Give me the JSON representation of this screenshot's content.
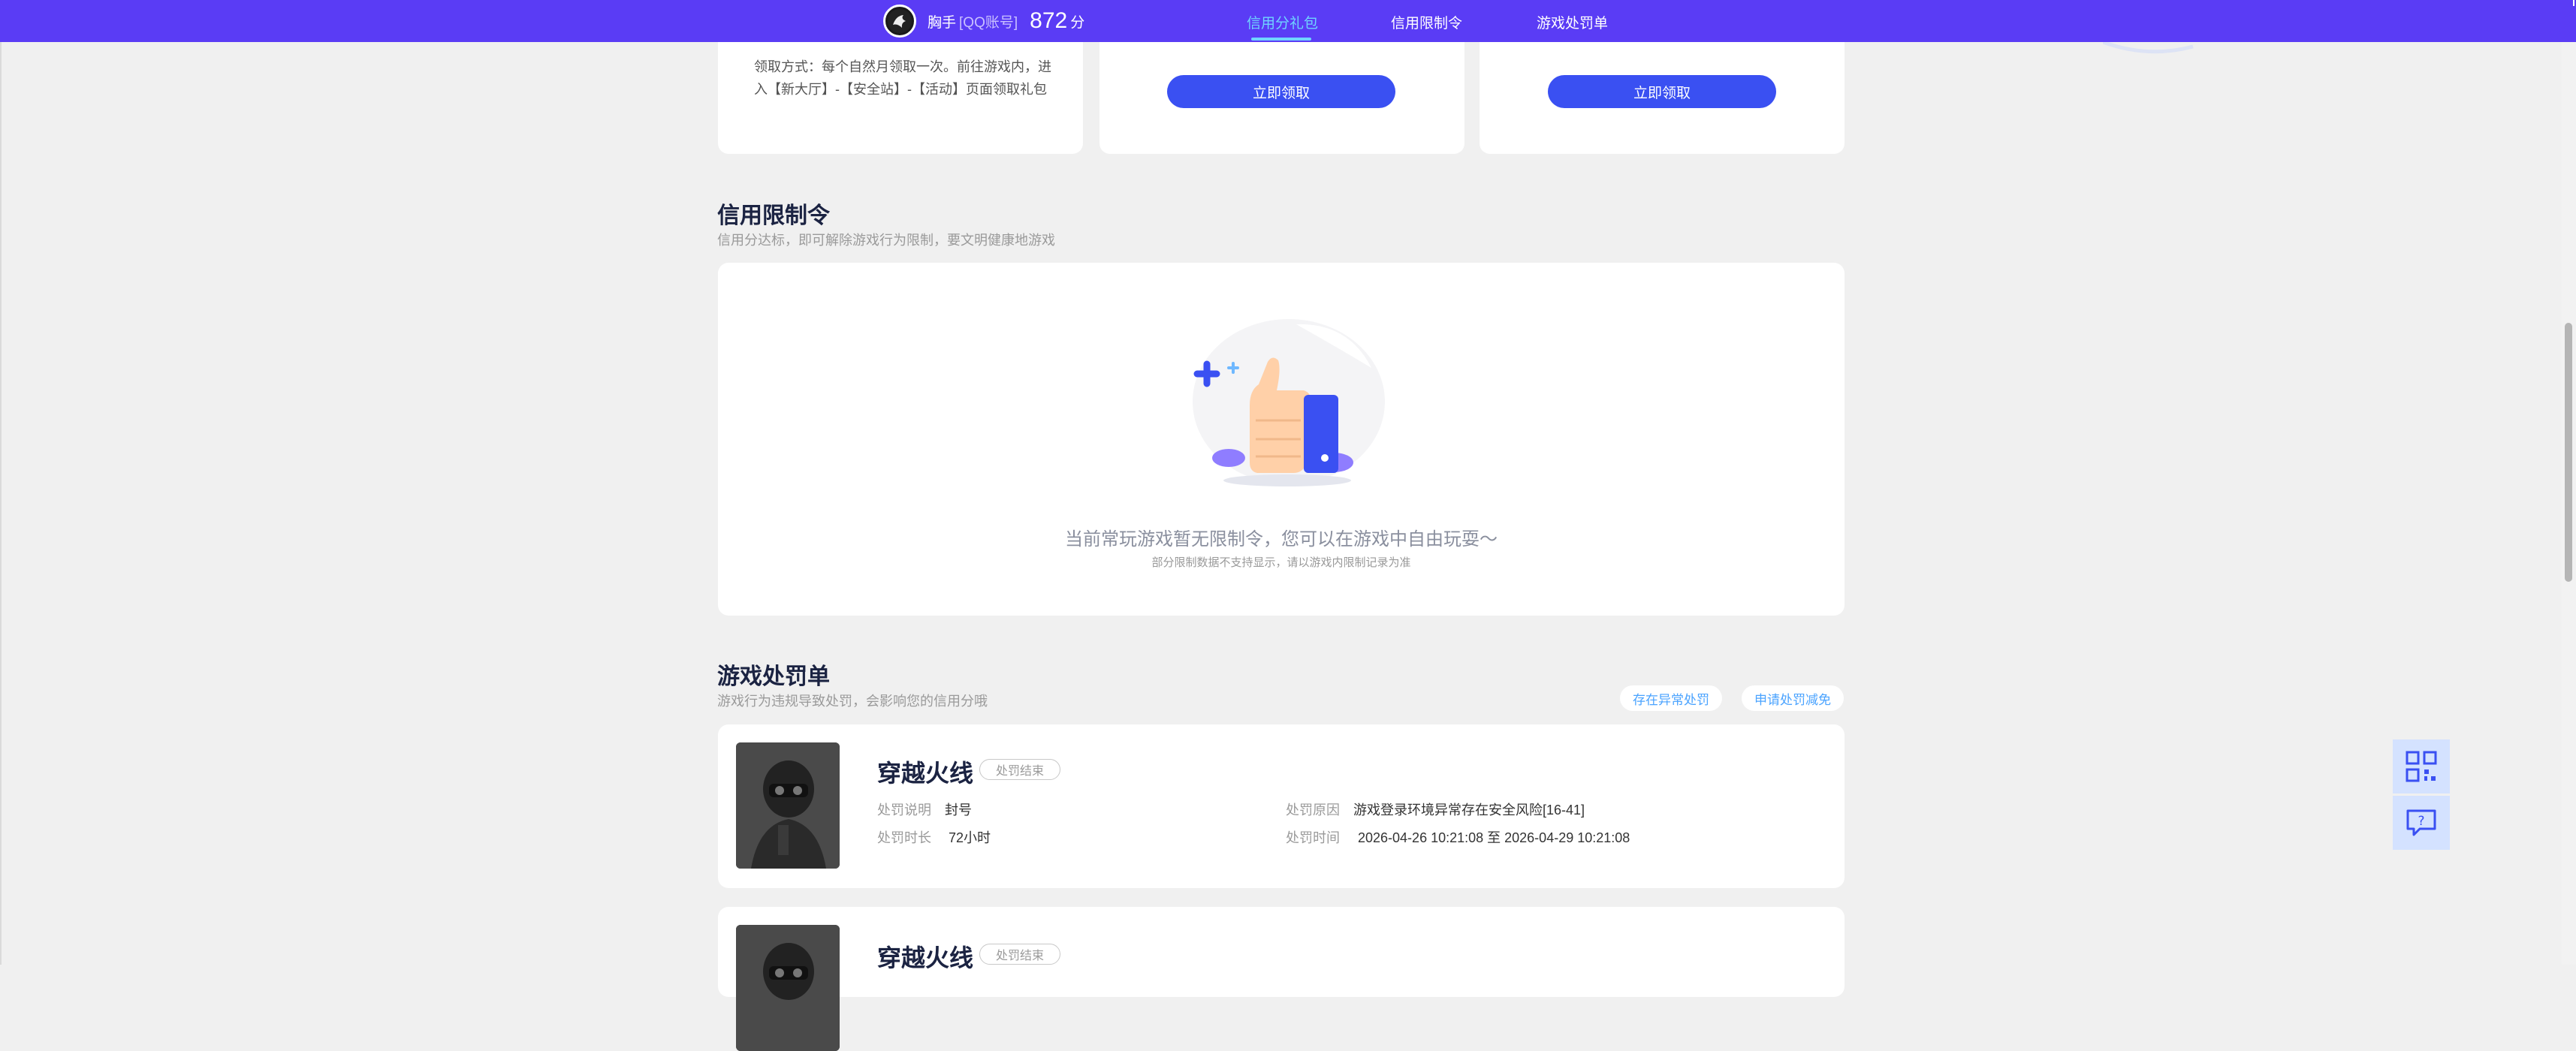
{
  "header": {
    "nickname": "胸手",
    "account_type": "[QQ账号]",
    "score": "872",
    "score_unit": "分",
    "nav": [
      {
        "label": "信用分礼包",
        "active": true
      },
      {
        "label": "信用限制令",
        "active": false
      },
      {
        "label": "游戏处罚单",
        "active": false
      }
    ],
    "accent_color": "#5a3cf5"
  },
  "gift_cards": {
    "claim_method": "领取方式：每个自然月领取一次。前往游戏内，进入【新大厅】-【安全站】-【活动】页面领取礼包",
    "claim_button_1": "立即领取",
    "claim_button_2": "立即领取"
  },
  "restriction": {
    "title": "信用限制令",
    "subtitle": "信用分达标，即可解除游戏行为限制，要文明健康地游戏",
    "empty_main": "当前常玩游戏暂无限制令，您可以在游戏中自由玩耍～",
    "empty_sub": "部分限制数据不支持显示，请以游戏内限制记录为准",
    "illustration_icon": "thumbs-up-icon"
  },
  "penalty": {
    "title": "游戏处罚单",
    "subtitle": "游戏行为违规导致处罚，会影响您的信用分哦",
    "btn_abnormal": "存在异常处罚",
    "btn_reduce": "申请处罚减免",
    "items": [
      {
        "game": "穿越火线",
        "status": "处罚结束",
        "desc_label": "处罚说明",
        "desc_value": "封号",
        "duration_label": "处罚时长",
        "duration_value": "72小时",
        "reason_label": "处罚原因",
        "reason_value": "游戏登录环境异常存在安全风险[16-41]",
        "time_label": "处罚时间",
        "time_value": "2026-04-26 10:21:08 至 2026-04-29 10:21:08"
      },
      {
        "game": "穿越火线",
        "status": "处罚结束"
      }
    ]
  },
  "float_tools": [
    "qr-code-icon",
    "feedback-icon"
  ]
}
